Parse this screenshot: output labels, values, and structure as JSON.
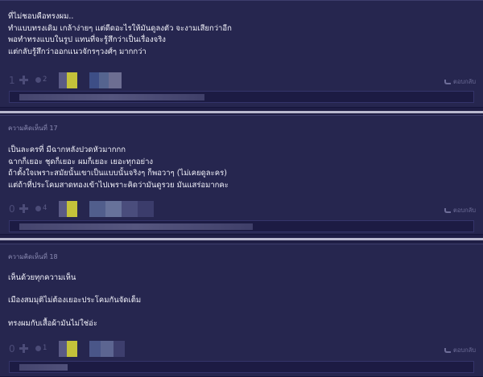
{
  "comments": [
    {
      "header": "",
      "lines": [
        "ที่ไม่ชอบคือทรงผม..",
        "ทำแบบทรงเดิม เกล้าง่ายๆ แต่ดีดอะไรให้มันดูลงตัว จะงามเสียกว่าอีก",
        "พอทำทรงแบบในรูป แทนที่จะรู้สึกว่าเป็นเรื่องจริง",
        "แต่กลับรู้สึกว่าออกแนวจักรๆวงศ์ๆ มากกว่า"
      ],
      "votes": "1",
      "emotions": "2",
      "reply": "ตอบกลับ"
    },
    {
      "header": "ความคิดเห็นที่ 17",
      "lines": [
        "เป็นละครที่ มีฉากหลังปวดหัวมากกก",
        "ฉากก็เยอะ ชุดก็เยอะ ผมก็เยอะ เยอะทุกอย่าง",
        "ถ้าตั้งใจเพราะสมัยนั้นเขาเป็นแบบนั้นจริงๆ ก็พอวาๆ (ไม่เคยดูละคร)",
        "แต่ถ้าที่ประโคมสาดทองเข้าไปเพราะคิดว่ามันดูรวย มันแสร่อมากคะ"
      ],
      "votes": "0",
      "emotions": "4",
      "reply": "ตอบกลับ"
    },
    {
      "header": "ความคิดเห็นที่ 18",
      "lines": [
        "เห็นด้วยทุกความเห็น",
        "",
        "เมืองสมมุติไม่ต้องเยอะประโคมกันจัดเต็ม",
        "",
        "ทรงผมกับเสื้อผ้ามันไม่ใช่อ่ะ"
      ],
      "votes": "0",
      "emotions": "1",
      "reply": "ตอบกลับ"
    }
  ],
  "colors": {
    "background": "#1f1e45",
    "card": "#26264f",
    "divider": "#b9b9cf",
    "avatar_accent": "#c4c23a",
    "muted": "#4c4c78"
  }
}
